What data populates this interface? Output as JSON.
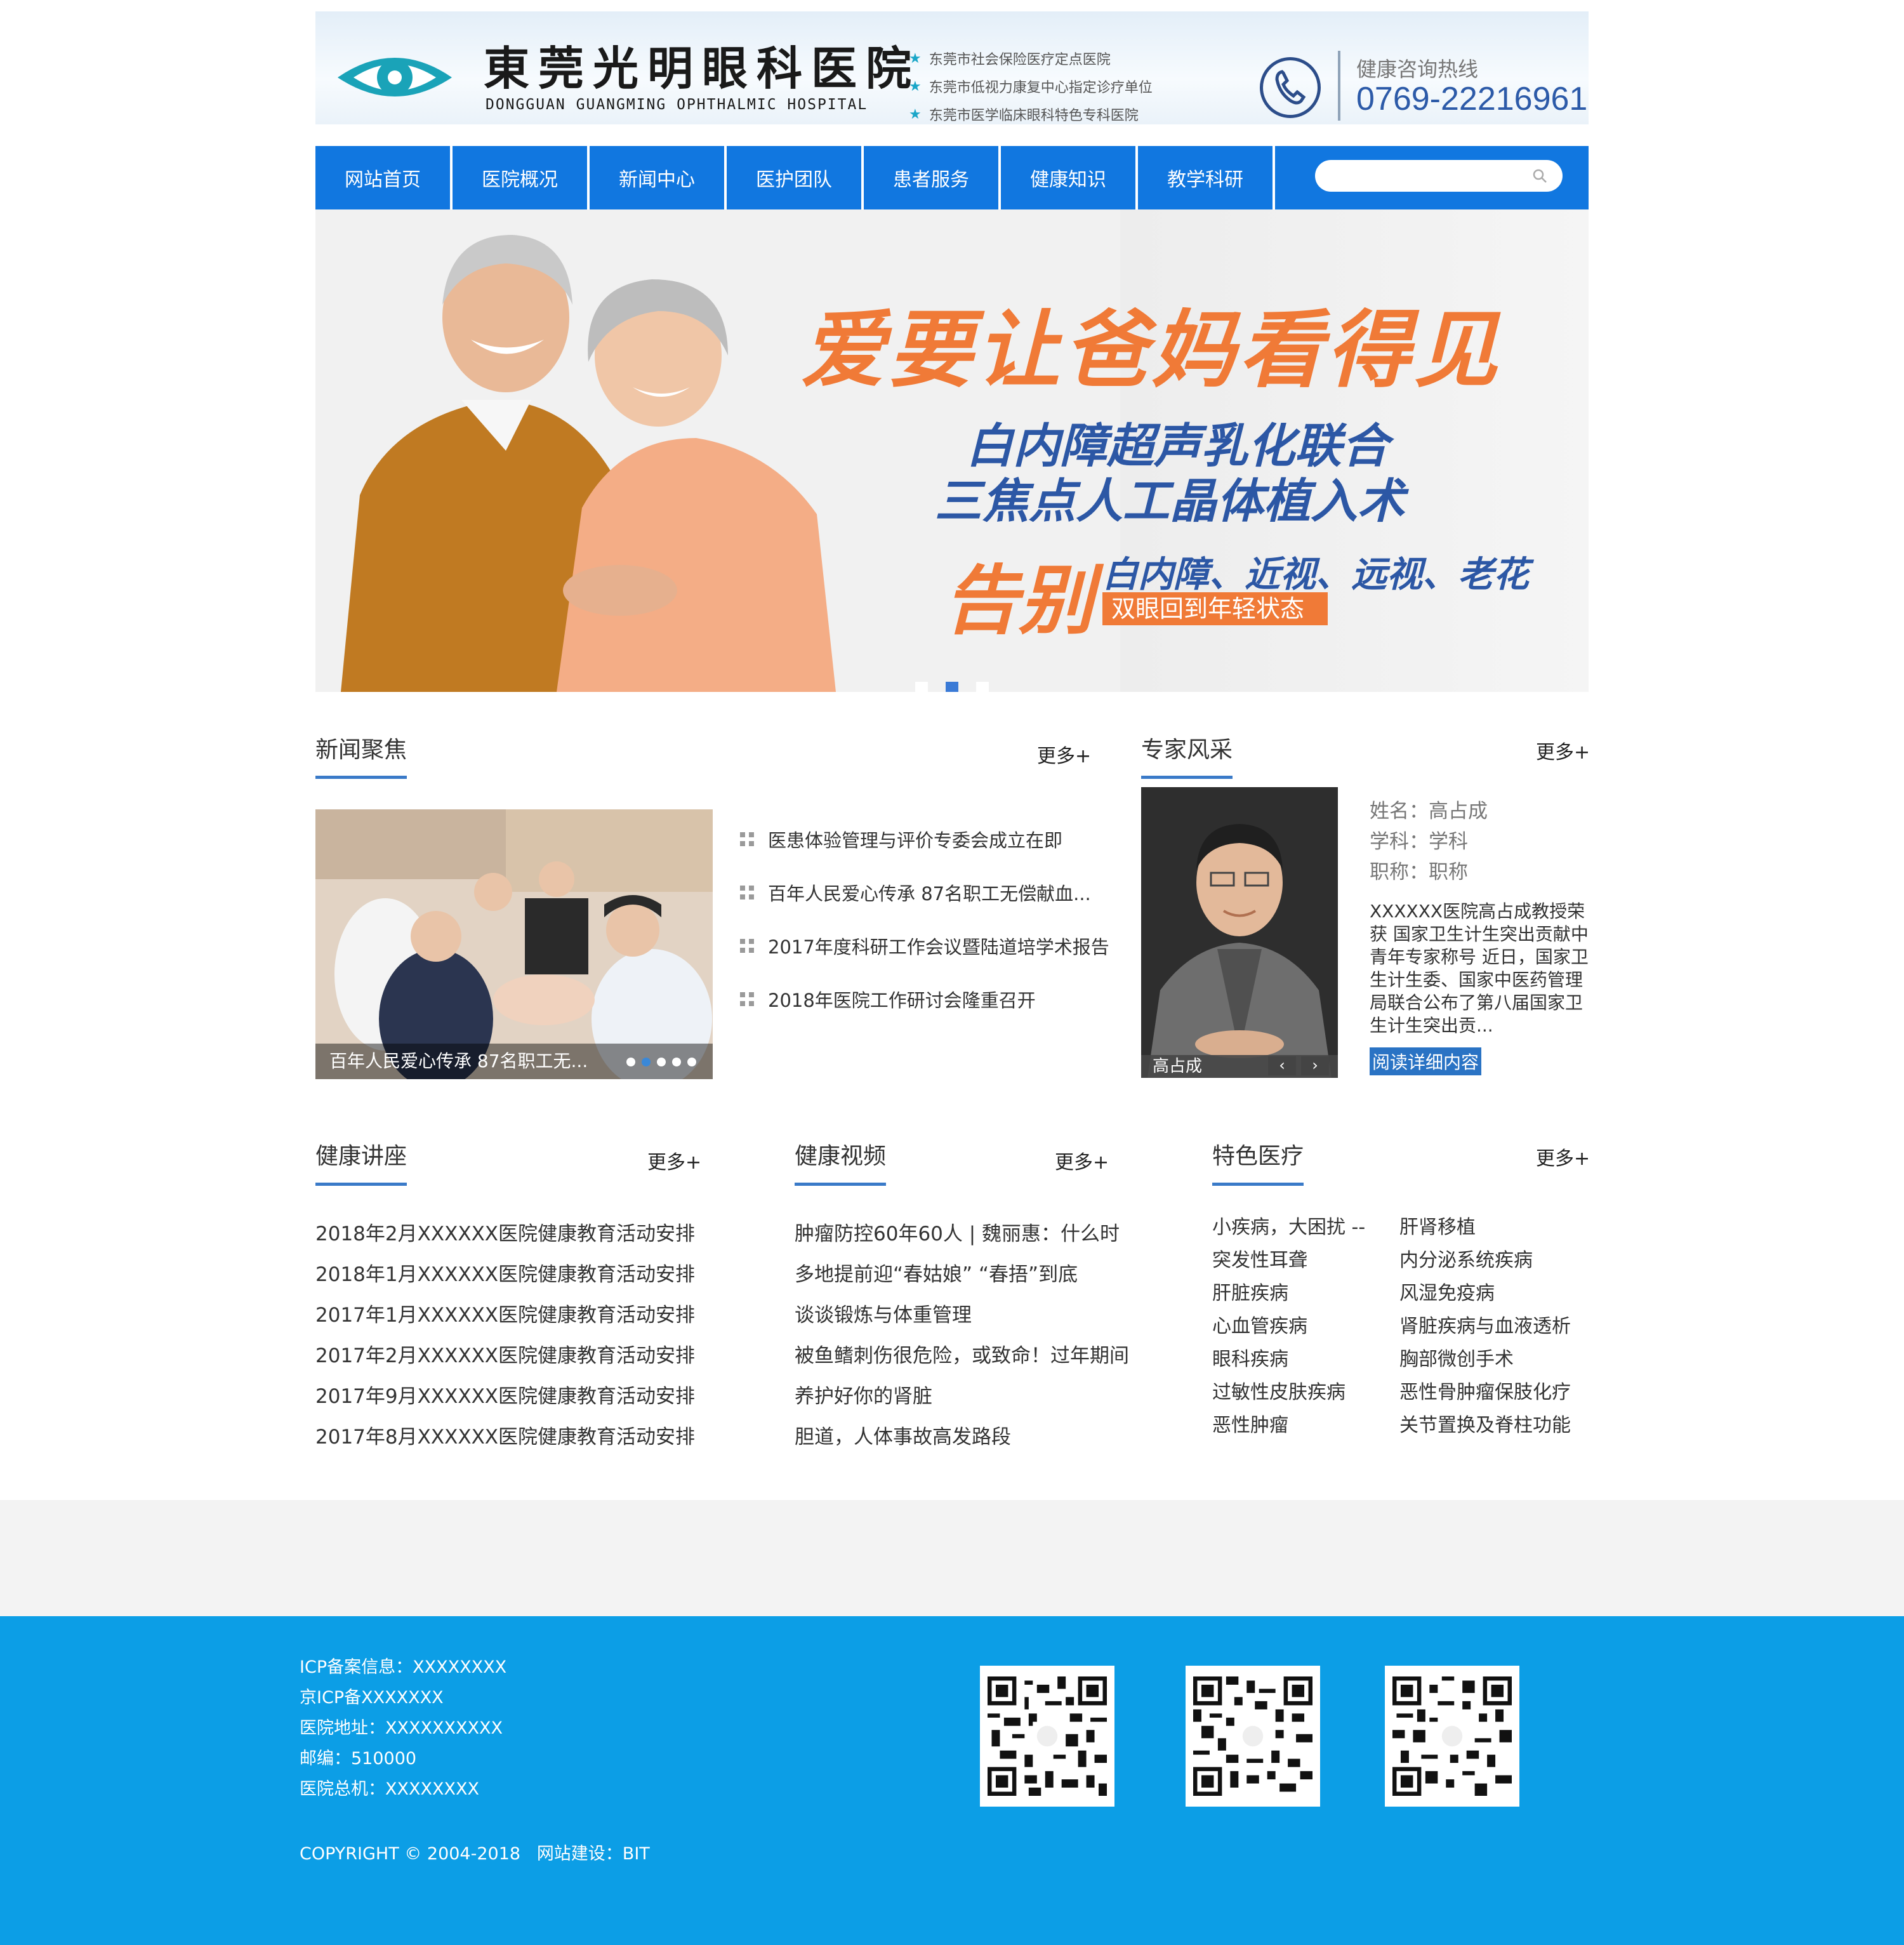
{
  "header": {
    "logo_cn": "東莞光明眼科医院",
    "logo_en": "DONGGUAN GUANGMING OPHTHALMIC HOSPITAL",
    "tags": [
      "东莞市社会保险医疗定点医院",
      "东莞市低视力康复中心指定诊疗单位",
      "东莞市医学临床眼科特色专科医院"
    ],
    "hotline_label": "健康咨询热线",
    "hotline_number": "0769-22216961"
  },
  "nav": {
    "items": [
      "网站首页",
      "医院概况",
      "新闻中心",
      "医护团队",
      "患者服务",
      "健康知识",
      "教学科研"
    ],
    "search_placeholder": ""
  },
  "banner": {
    "title": "爱要让爸妈看得见",
    "subtitle_line1": "白内障超声乳化联合",
    "subtitle_line2": "三焦点人工晶体植入术",
    "farewell": "告别",
    "conditions": "白内障、近视、远视、老花",
    "tagline": "双眼回到年轻状态",
    "slide_count": 3,
    "active_slide": 2
  },
  "news": {
    "title": "新闻聚焦",
    "more": "更多+",
    "photo_caption": "百年人民爱心传承 87名职工无...",
    "photo_slide_count": 5,
    "photo_active_slide": 2,
    "items": [
      "医患体验管理与评价专委会成立在即",
      "百年人民爱心传承 87名职工无偿献血...",
      "2017年度科研工作会议暨陆道培学术报告",
      "2018年医院工作研讨会隆重召开"
    ]
  },
  "expert": {
    "title": "专家风采",
    "more": "更多+",
    "caption": "高占成",
    "prev": "‹",
    "next": "›",
    "name": "姓名：高占成",
    "subject": "学科：学科",
    "rank": "职称：职称",
    "desc": "XXXXXX医院高占成教授荣获 国家卫生计生突出贡献中青年专家称号 近日，国家卫生计生委、国家中医药管理局联合公布了第八届国家卫生计生突出贡...",
    "read_more": "阅读详细内容"
  },
  "lectures": {
    "title": "健康讲座",
    "more": "更多+",
    "items": [
      "2018年2月XXXXXX医院健康教育活动安排",
      "2018年1月XXXXXX医院健康教育活动安排",
      "2017年1月XXXXXX医院健康教育活动安排",
      "2017年2月XXXXXX医院健康教育活动安排",
      "2017年9月XXXXXX医院健康教育活动安排",
      "2017年8月XXXXXX医院健康教育活动安排"
    ]
  },
  "videos": {
    "title": "健康视频",
    "more": "更多+",
    "items": [
      "肿瘤防控60年60人 | 魏丽惠：什么时",
      "多地提前迎“春姑娘” “春捂”到底",
      "谈谈锻炼与体重管理",
      "被鱼鳍刺伤很危险，或致命！过年期间",
      "养护好你的肾脏",
      "胆道，人体事故高发路段"
    ]
  },
  "special": {
    "title": "特色医疗",
    "more": "更多+",
    "items": [
      "小疾病，大困扰 --",
      "肝肾移植",
      "突发性耳聋",
      "内分泌系统疾病",
      "肝脏疾病",
      "风湿免疫病",
      "心血管疾病",
      "肾脏疾病与血液透析",
      "眼科疾病",
      "胸部微创手术",
      "过敏性皮肤疾病",
      "恶性骨肿瘤保肢化疗",
      "恶性肿瘤",
      "关节置换及脊柱功能"
    ]
  },
  "footer": {
    "lines": [
      "ICP备案信息：XXXXXXXX",
      "京ICP备XXXXXXX",
      "医院地址：XXXXXXXXXX",
      "邮编：510000",
      "医院总机：XXXXXXXX"
    ],
    "copyright": "COPYRIGHT © 2004-2018",
    "builder": "网站建设：BIT"
  },
  "colors": {
    "nav_blue": "#1177e0",
    "footer_blue": "#0c9ee6",
    "accent_orange": "#f07a37",
    "banner_blue_text": "#2c57a5"
  }
}
